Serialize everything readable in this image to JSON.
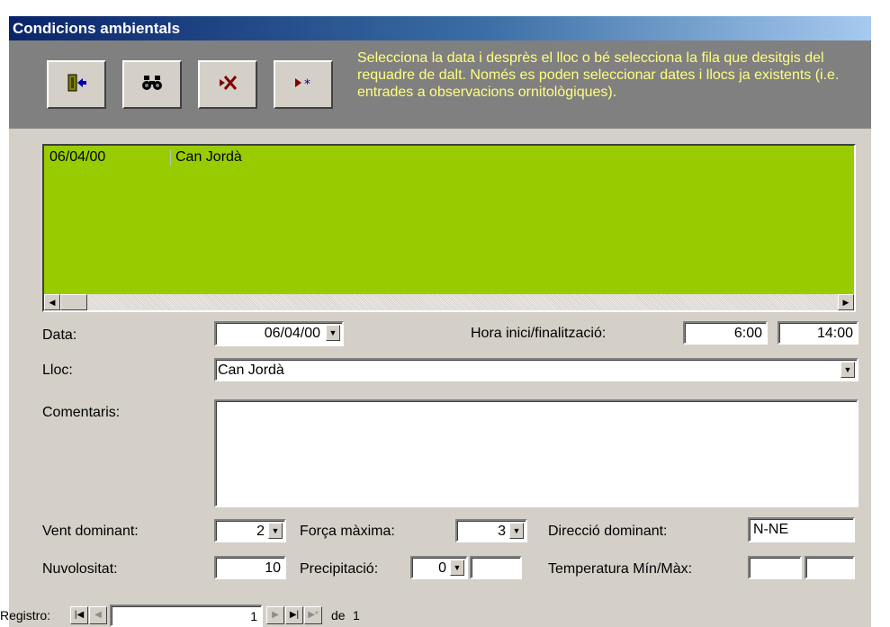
{
  "window": {
    "title": "Condicions ambientals"
  },
  "toolbar": {
    "hint": "Selecciona la data i desprès el lloc o bé selecciona la fila que desitgis del requadre de dalt. Només es poden seleccionar dates i llocs ja existents (i.e. entrades a observacions ornitològiques).",
    "buttons": [
      "exit-icon",
      "find-icon",
      "delete-record-icon",
      "new-record-icon"
    ]
  },
  "list": {
    "rows": [
      {
        "date": "06/04/00",
        "place": "Can Jordà"
      }
    ]
  },
  "form": {
    "data_label": "Data:",
    "data_value": "06/04/00",
    "hora_label": "Hora inici/finalització:",
    "hora_inici": "6:00",
    "hora_fi": "14:00",
    "lloc_label": "Lloc:",
    "lloc_value": "Can Jordà",
    "comentaris_label": "Comentaris:",
    "comentaris_value": "",
    "vent_label": "Vent dominant:",
    "vent_value": "2",
    "forca_label": "Força màxima:",
    "forca_value": "3",
    "direccio_label": "Direcció dominant:",
    "direccio_value": "N-NE",
    "nuvol_label": "Nuvolositat:",
    "nuvol_value": "10",
    "precip_label": "Precipitació:",
    "precip_value": "0",
    "precip_extra": "",
    "temp_label": "Temperatura Mín/Màx:",
    "temp_min": "",
    "temp_max": ""
  },
  "navigation": {
    "label": "Registro:",
    "current": "1",
    "of_label": "de",
    "total": "1"
  },
  "colors": {
    "list_bg": "#99cc00",
    "hint_text": "#ffff80",
    "title_bar": "#0a246a"
  }
}
